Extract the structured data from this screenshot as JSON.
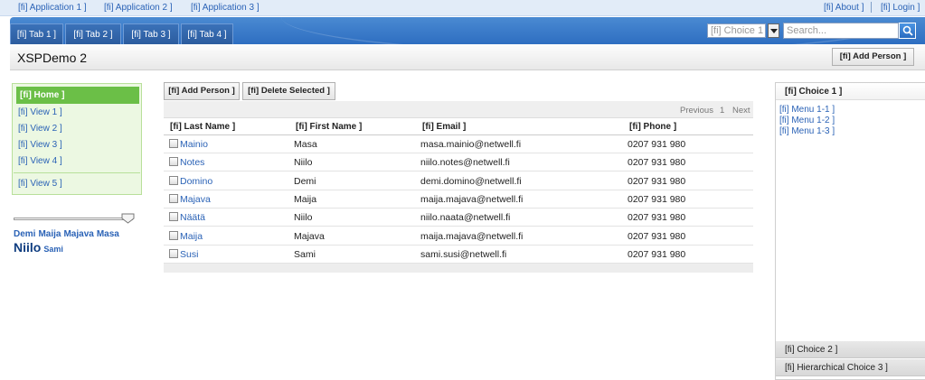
{
  "top_links": {
    "apps": [
      "[fi] Application 1 ]",
      "[fi] Application 2 ]",
      "[fi] Application 3 ]"
    ],
    "about": "[fi] About ]",
    "login": "[fi] Login ]"
  },
  "tabs": [
    "[fi] Tab 1 ]",
    "[fi] Tab 2 ]",
    "[fi] Tab 3 ]",
    "[fi] Tab 4 ]"
  ],
  "search": {
    "choice_value": "[fi] Choice 1 ]",
    "placeholder": "Search..."
  },
  "header": {
    "title": "XSPDemo 2",
    "add_person": "[fi] Add Person ]"
  },
  "leftnav": {
    "home": "[fi] Home ]",
    "views": [
      "[fi] View 1 ]",
      "[fi] View 2 ]",
      "[fi] View 3 ]",
      "[fi] View 4 ]"
    ],
    "view5": "[fi] View 5 ]"
  },
  "slider": {
    "level": 0.96
  },
  "tagcloud": {
    "line1": [
      "Demi",
      "Maija",
      "Majava",
      "Masa"
    ],
    "line2_big": "Niilo",
    "line2_small": "Sami"
  },
  "toolbar": {
    "add_person": "[fi] Add Person ]",
    "delete_selected": "[fi] Delete Selected ]"
  },
  "pager": {
    "previous": "Previous",
    "page": "1",
    "next": "Next"
  },
  "table": {
    "columns": [
      "[fi] Last Name ]",
      "[fi] First Name ]",
      "[fi] Email ]",
      "[fi] Phone ]"
    ],
    "rows": [
      {
        "last": "Mainio",
        "first": "Masa",
        "email": "masa.mainio@netwell.fi",
        "phone": "0207 931 980"
      },
      {
        "last": "Notes",
        "first": "Niilo",
        "email": "niilo.notes@netwell.fi",
        "phone": "0207 931 980"
      },
      {
        "last": "Domino",
        "first": "Demi",
        "email": "demi.domino@netwell.fi",
        "phone": "0207 931 980"
      },
      {
        "last": "Majava",
        "first": "Maija",
        "email": "maija.majava@netwell.fi",
        "phone": "0207 931 980"
      },
      {
        "last": "Näätä",
        "first": "Niilo",
        "email": "niilo.naata@netwell.fi",
        "phone": "0207 931 980"
      },
      {
        "last": "Maija",
        "first": "Majava",
        "email": "maija.majava@netwell.fi",
        "phone": "0207 931 980"
      },
      {
        "last": "Susi",
        "first": "Sami",
        "email": "sami.susi@netwell.fi",
        "phone": "0207 931 980"
      }
    ]
  },
  "rightcol": {
    "choice1": "[fi] Choice 1 ]",
    "menus": [
      "[fi] Menu 1-1 ]",
      "[fi] Menu 1-2 ]",
      "[fi] Menu 1-3 ]"
    ],
    "choice2": "[fi] Choice 2 ]",
    "hier_choice3": "[fi] Hierarchical Choice 3 ]"
  },
  "colors": {
    "link": "#2a62b6",
    "tabbar": "#2e6ec1",
    "nav_active": "#6bbf47",
    "nav_bg": "#ecf8e2"
  },
  "icons": {
    "search": "search-icon",
    "dropdown": "chevron-down-icon"
  }
}
